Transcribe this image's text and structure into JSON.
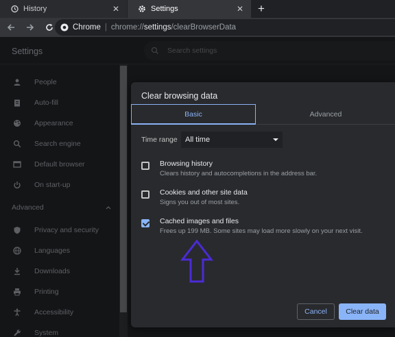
{
  "tabs": [
    {
      "title": "History",
      "icon": "history-icon",
      "active": false
    },
    {
      "title": "Settings",
      "icon": "gear-icon",
      "active": true
    }
  ],
  "new_tab_label": "+",
  "close_glyph": "✕",
  "omnibox": {
    "site_name": "Chrome",
    "separator": "|",
    "url_prefix": "chrome://",
    "url_bold": "settings",
    "url_suffix": "/clearBrowserData"
  },
  "settings": {
    "title": "Settings",
    "search_placeholder": "Search settings",
    "nav_items": [
      {
        "label": "People",
        "icon": "person-icon"
      },
      {
        "label": "Auto-fill",
        "icon": "clipboard-icon"
      },
      {
        "label": "Appearance",
        "icon": "palette-icon"
      },
      {
        "label": "Search engine",
        "icon": "search-icon"
      },
      {
        "label": "Default browser",
        "icon": "browser-icon"
      },
      {
        "label": "On start-up",
        "icon": "power-icon"
      }
    ],
    "advanced_label": "Advanced",
    "advanced_items": [
      {
        "label": "Privacy and security",
        "icon": "shield-icon"
      },
      {
        "label": "Languages",
        "icon": "globe-icon"
      },
      {
        "label": "Downloads",
        "icon": "download-icon"
      },
      {
        "label": "Printing",
        "icon": "printer-icon"
      },
      {
        "label": "Accessibility",
        "icon": "accessibility-icon"
      },
      {
        "label": "System",
        "icon": "wrench-icon"
      }
    ]
  },
  "dialog": {
    "title": "Clear browsing data",
    "tab_basic": "Basic",
    "tab_advanced": "Advanced",
    "time_range_label": "Time range",
    "time_range_value": "All time",
    "options": [
      {
        "title": "Browsing history",
        "desc": "Clears history and autocompletions in the address bar.",
        "checked": false
      },
      {
        "title": "Cookies and other site data",
        "desc": "Signs you out of most sites.",
        "checked": false
      },
      {
        "title": "Cached images and files",
        "desc": "Frees up 199 MB. Some sites may load more slowly on your next visit.",
        "checked": true
      }
    ],
    "cancel_label": "Cancel",
    "clear_label": "Clear data"
  },
  "colors": {
    "accent": "#8ab4f8",
    "annotation_arrow": "#4b2bd6"
  }
}
